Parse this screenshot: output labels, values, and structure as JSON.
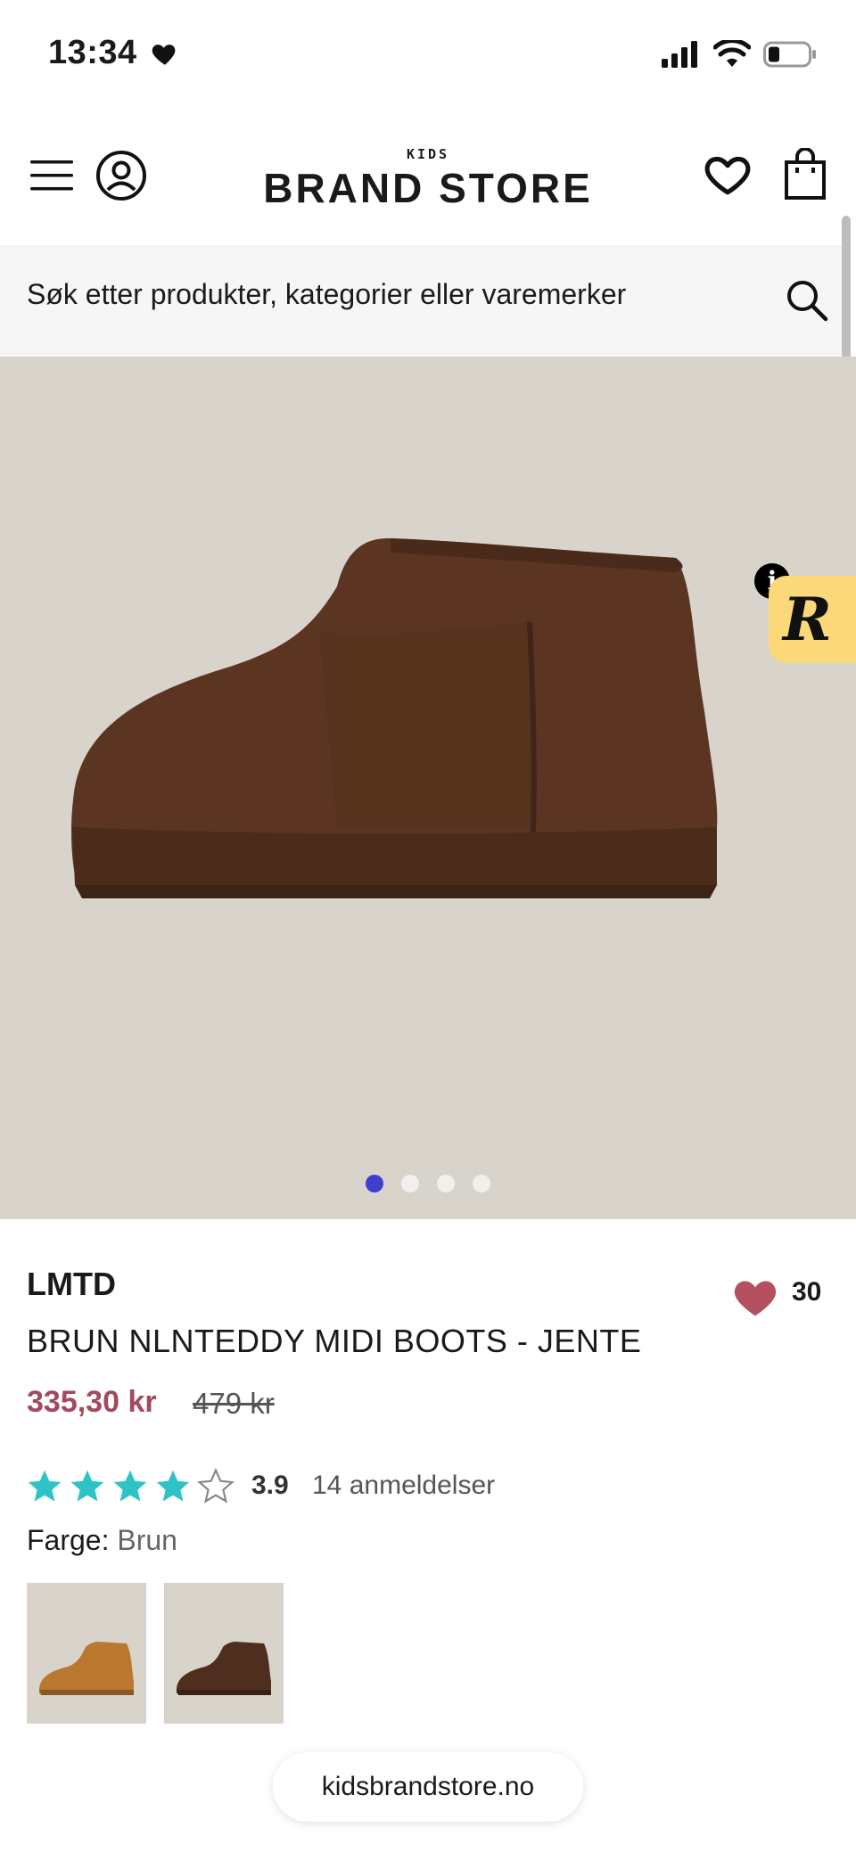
{
  "status": {
    "time": "13:34"
  },
  "header": {
    "logo_small": "KIDS",
    "logo_main": "BRAND STORE"
  },
  "search": {
    "placeholder": "Søk etter produkter, kategorier eller varemerker"
  },
  "hero": {
    "active_slide": 1,
    "slide_count": 4,
    "badge_letter": "R",
    "info_letter": "i"
  },
  "product": {
    "brand": "LMTD",
    "name": "BRUN NLNTEDDY MIDI BOOTS - JENTE",
    "price": "335,30 kr",
    "old_price": "479 kr",
    "favorites_count": "30",
    "rating": "3.9",
    "rating_stars_filled": 4,
    "rating_stars_total": 5,
    "reviews": "14 anmeldelser",
    "color_label": "Farge:",
    "color_value": "Brun"
  },
  "colors": {
    "accent": "#3f3fcf",
    "price": "#a24a5e",
    "star": "#2ec4c7",
    "badge": "#fbd978"
  },
  "footer": {
    "url": "kidsbrandstore.no"
  }
}
